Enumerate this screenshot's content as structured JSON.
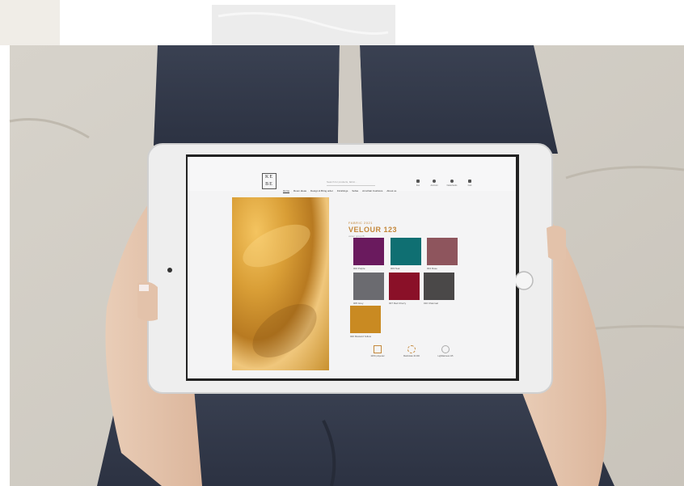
{
  "screen": {
    "logo": {
      "line1": "KE",
      "line2": "BE"
    },
    "search_placeholder": "Search for products, fabric...",
    "nav": [
      "Home",
      "Room ideas",
      "Design & Bring order",
      "Finishings",
      "Sofas",
      "Armchair Cushions",
      "About us"
    ],
    "header_icons": [
      {
        "name": "favorites-icon",
        "label": "Fav"
      },
      {
        "name": "account-icon",
        "label": "Account"
      },
      {
        "name": "language-icon",
        "label": "Nederlands"
      },
      {
        "name": "cart-icon",
        "label": "Cart"
      }
    ],
    "product": {
      "eyebrow": "FABRIC 2021",
      "title": "VELOUR 123",
      "subtitle": "velour group B"
    },
    "swatches": [
      {
        "label": "002 Purple",
        "color": "#6a1a5e"
      },
      {
        "label": "003 Teal",
        "color": "#0f6f72"
      },
      {
        "label": "004 Rose",
        "color": "#8e555d"
      },
      {
        "label": "005 Grey",
        "color": "#6b6b70"
      },
      {
        "label": "007 Red Cherry",
        "color": "#8a1028"
      },
      {
        "label": "010 Charcoal",
        "color": "#4a4848"
      },
      {
        "label": "020 Mustard Yellow",
        "color": "#c98a22"
      }
    ],
    "specs": [
      {
        "label": "100% polyester"
      },
      {
        "label": "Martindale 40.000"
      },
      {
        "label": "Lightfastness 4/5"
      }
    ]
  }
}
